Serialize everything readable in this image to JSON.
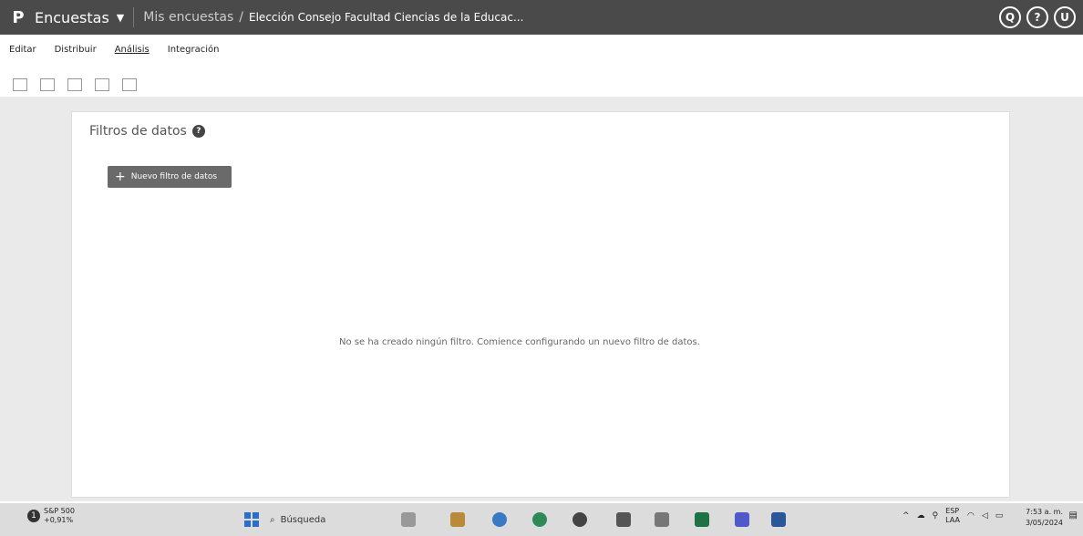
{
  "topbar": {
    "app_name": "Encuestas",
    "crumb_parent": "Mis encuestas",
    "crumb_separator": "/",
    "crumb_current": "Elección Consejo Facultad Ciencias de la Educac...",
    "search_glyph": "Q",
    "help_glyph": "?",
    "user_initial": "U"
  },
  "menu": {
    "items": [
      "Editar",
      "Distribuir",
      "Análisis",
      "Integración"
    ],
    "active": "Análisis"
  },
  "card": {
    "title": "Filtros de datos",
    "add_button": "Nuevo filtro de datos",
    "empty_message": "No se ha creado ningún filtro. Comience configurando un nuevo filtro de datos."
  },
  "taskbar": {
    "stock_name": "S&P 500",
    "stock_change": "+0,91%",
    "stock_badge": "1",
    "search_placeholder": "Búsqueda",
    "lang_top": "ESP",
    "lang_bottom": "LAA",
    "time": "7:53 a. m.",
    "date": "3/05/2024"
  },
  "colors": {
    "topbar": "#4a4a4a",
    "page_bg": "#eaeaea",
    "button": "#6a6a6a"
  }
}
